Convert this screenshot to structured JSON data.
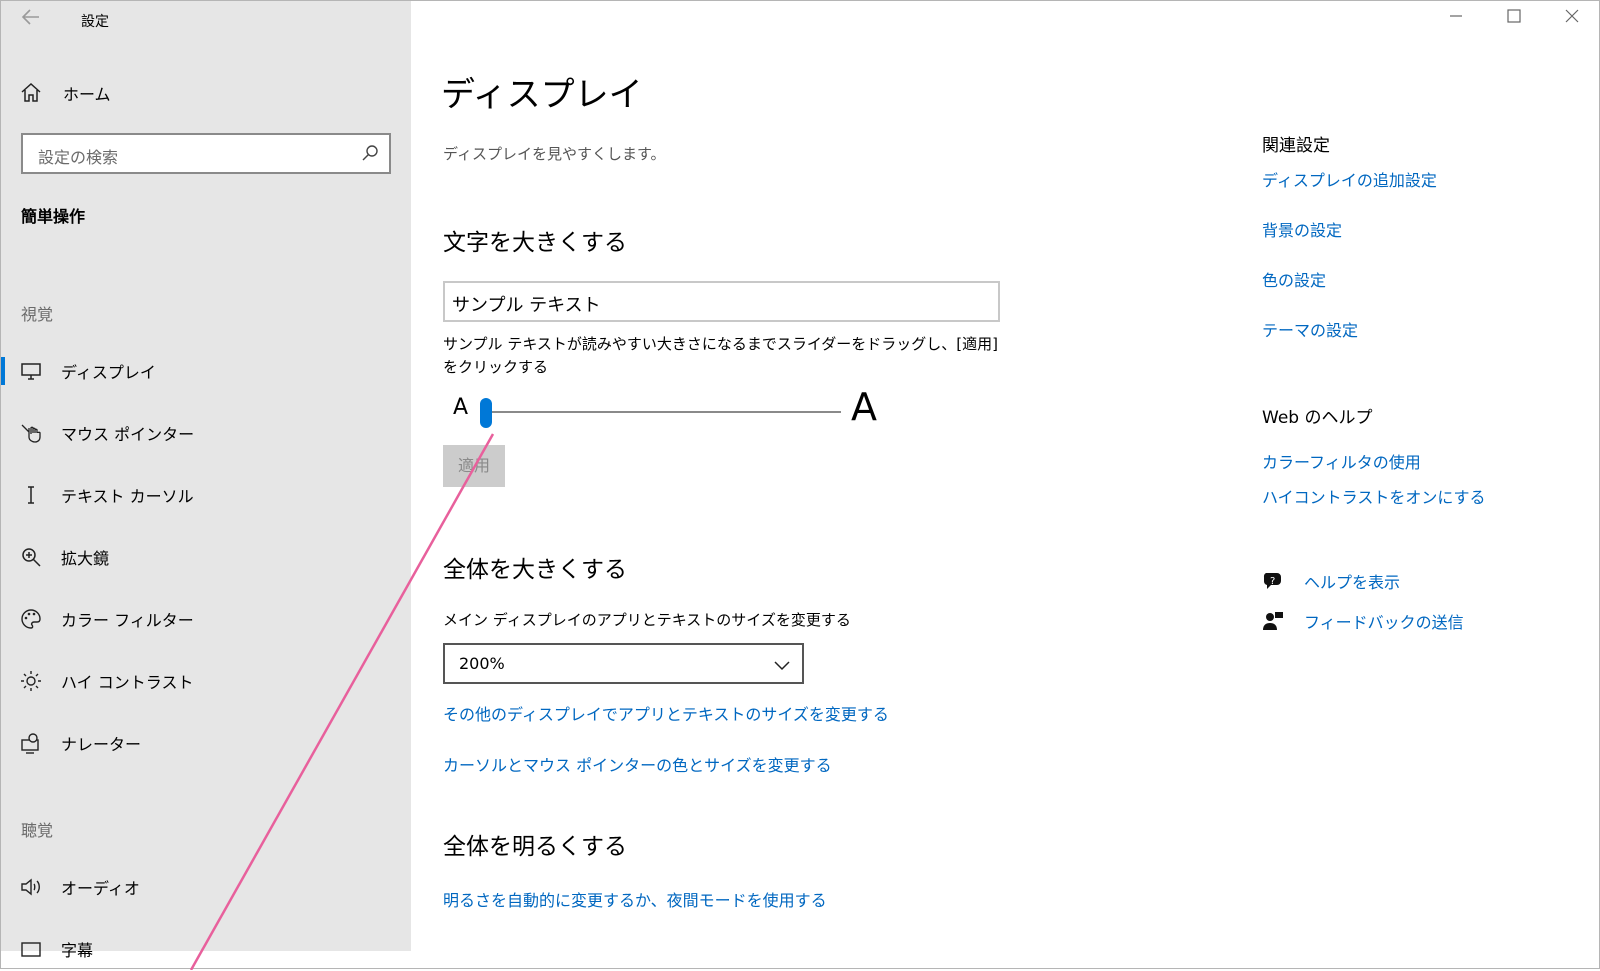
{
  "window": {
    "app_title": "設定",
    "back_icon": "back-arrow-icon",
    "controls": [
      "minimize-icon",
      "maximize-icon",
      "close-icon"
    ]
  },
  "sidebar": {
    "home_label": "ホーム",
    "search_placeholder": "設定の検索",
    "section_title": "簡単操作",
    "group_vision": "視覚",
    "vision_items": [
      {
        "label": "ディスプレイ",
        "icon": "monitor-icon",
        "active": true
      },
      {
        "label": "マウス ポインター",
        "icon": "mouse-pointer-icon"
      },
      {
        "label": "テキスト カーソル",
        "icon": "text-cursor-icon"
      },
      {
        "label": "拡大鏡",
        "icon": "magnifier-icon"
      },
      {
        "label": "カラー フィルター",
        "icon": "palette-icon"
      },
      {
        "label": "ハイ コントラスト",
        "icon": "sun-icon"
      },
      {
        "label": "ナレーター",
        "icon": "narrator-icon"
      }
    ],
    "group_hearing": "聴覚",
    "hearing_items": [
      {
        "label": "オーディオ",
        "icon": "speaker-icon"
      },
      {
        "label": "字幕",
        "icon": "captions-icon"
      }
    ]
  },
  "main": {
    "title": "ディスプレイ",
    "subtitle": "ディスプレイを見やすくします。",
    "text_section": {
      "heading": "文字を大きくする",
      "sample_text": "サンプル テキスト",
      "description": "サンプル テキストが読みやすい大きさになるまでスライダーをドラッグし、[適用] をクリックする",
      "slider_min_label": "A",
      "slider_max_label": "A",
      "slider_value_fraction": 0.0,
      "apply_label": "適用"
    },
    "scale_section": {
      "heading": "全体を大きくする",
      "description": "メイン ディスプレイのアプリとテキストのサイズを変更する",
      "selected_scale": "200%",
      "link_other_displays": "その他のディスプレイでアプリとテキストのサイズを変更する",
      "link_cursor": "カーソルとマウス ポインターの色とサイズを変更する"
    },
    "brightness_section": {
      "heading": "全体を明るくする",
      "link": "明るさを自動的に変更するか、夜間モードを使用する"
    }
  },
  "related": {
    "heading": "関連設定",
    "links": [
      "ディスプレイの追加設定",
      "背景の設定",
      "色の設定",
      "テーマの設定"
    ],
    "web_help_heading": "Web のヘルプ",
    "help_links": [
      "カラーフィルタの使用",
      "ハイコントラストをオンにする"
    ],
    "show_help": "ヘルプを表示",
    "send_feedback": "フィードバックの送信"
  },
  "colors": {
    "accent": "#0078d7",
    "link": "#0067c0",
    "sidebar_bg": "#e6e6e6",
    "annotation": "#e8609c"
  }
}
